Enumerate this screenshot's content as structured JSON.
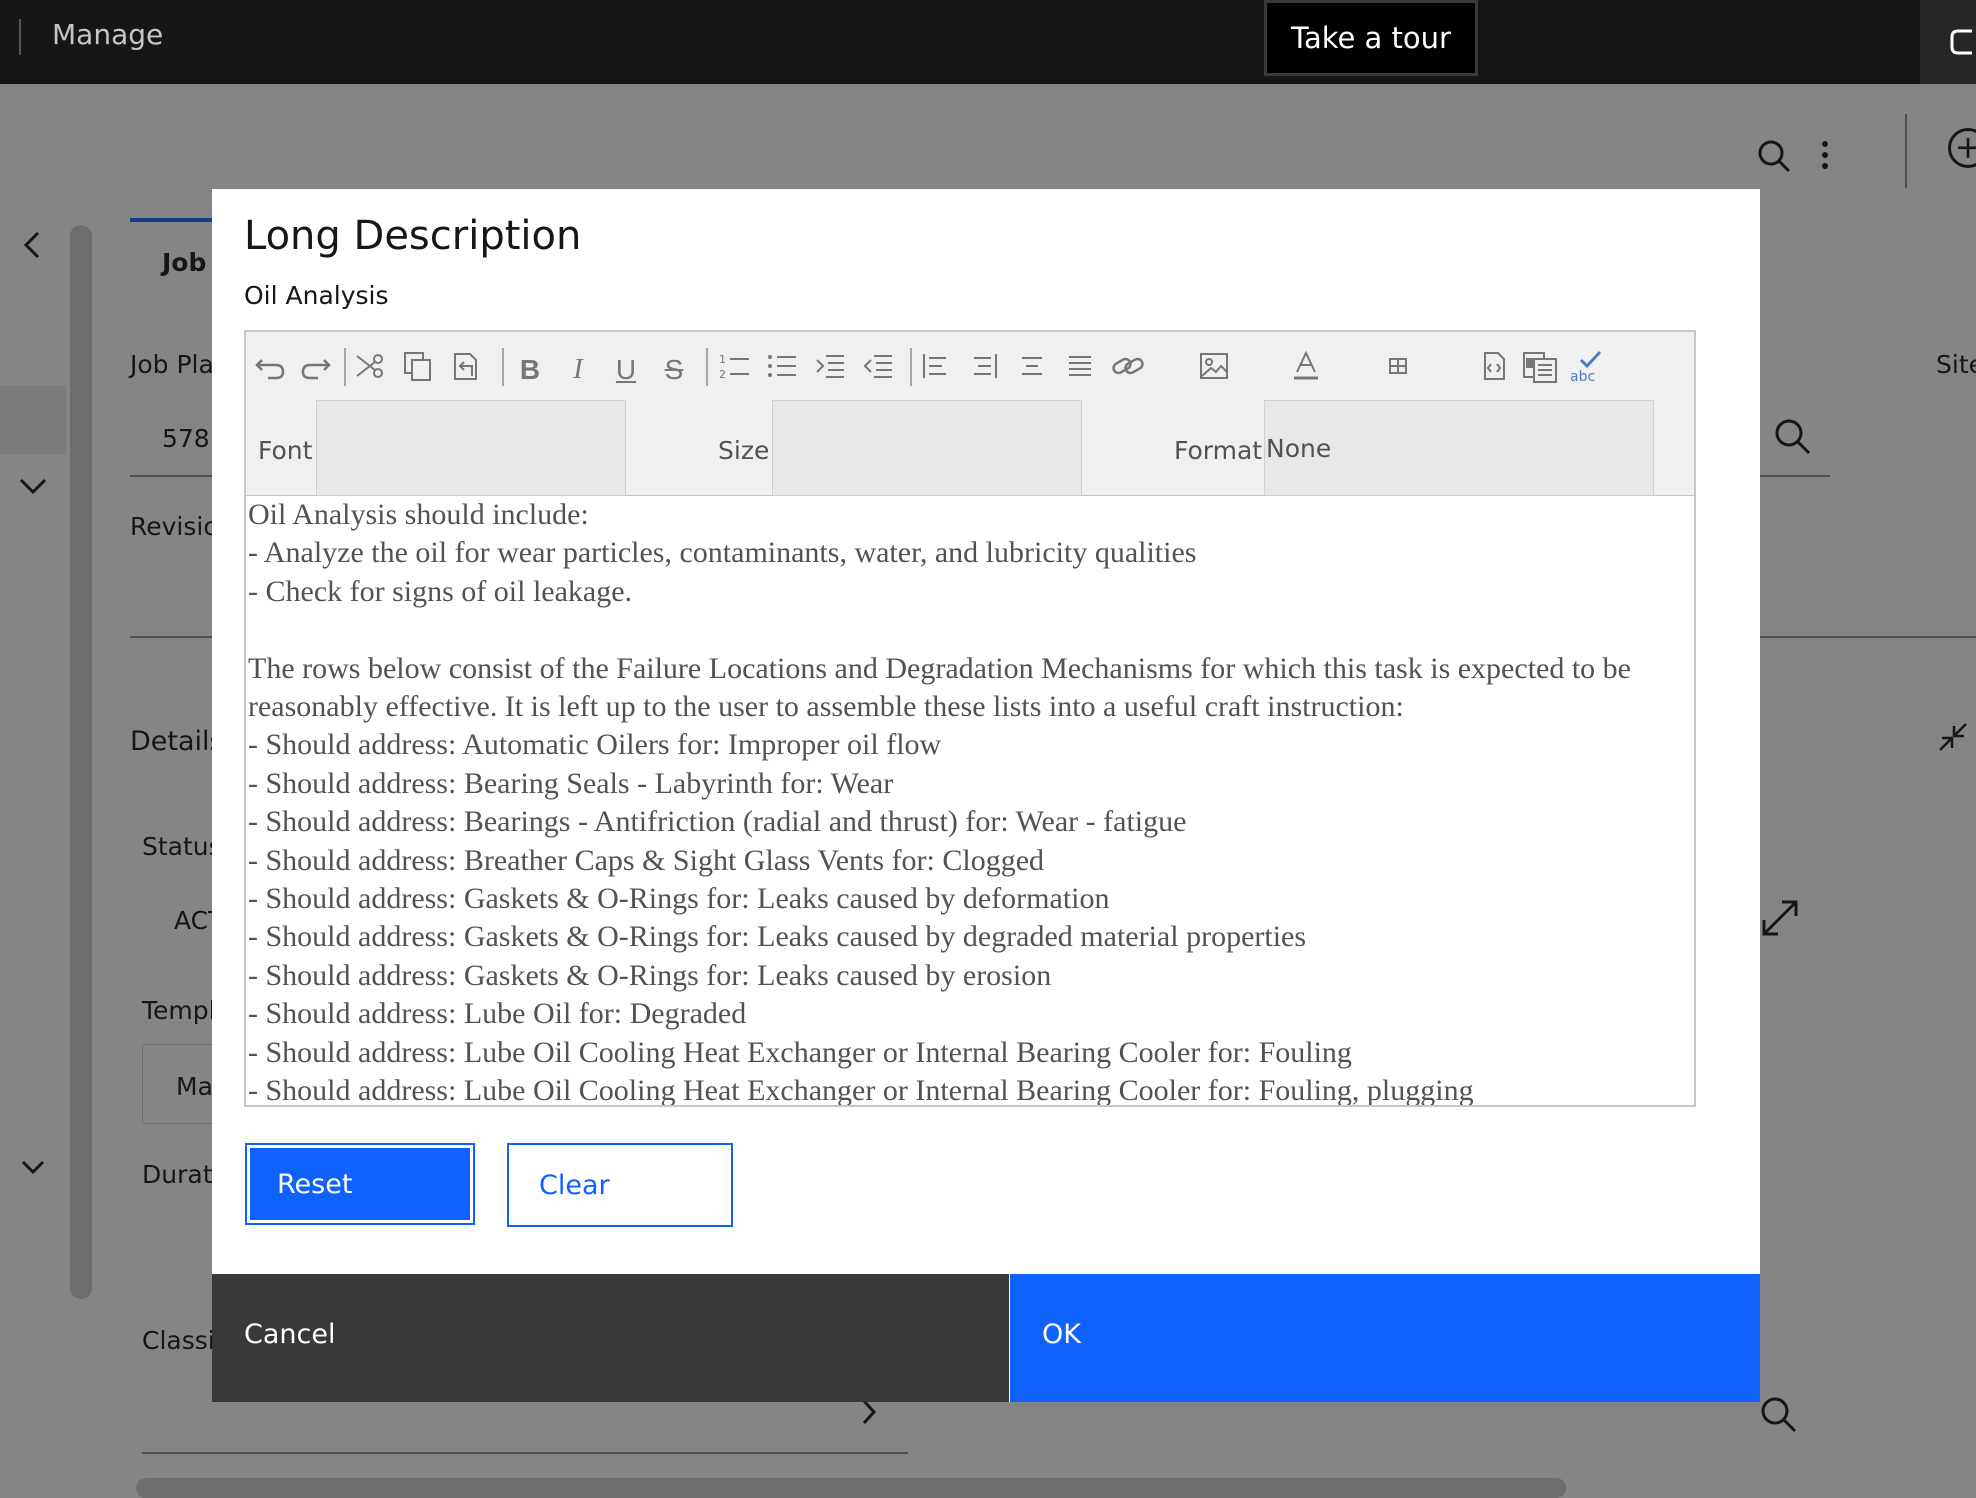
{
  "topbar": {
    "app_name": "Manage",
    "tour_button": "Take a tour"
  },
  "background": {
    "tab_label": "Job",
    "job_plan_label": "Job Pla",
    "job_plan_value": "578",
    "revision_label": "Revisio",
    "details_label": "Details",
    "status_label": "Status",
    "status_value": "ACT",
    "template_label": "Templ",
    "template_value": "Ma",
    "duration_label": "Durati",
    "classification_label": "Classi",
    "site_label": "Site"
  },
  "modal": {
    "title": "Long Description",
    "subtitle": "Oil Analysis",
    "editor": {
      "toolbar": {
        "font_label": "Font",
        "font_value": "",
        "size_label": "Size",
        "size_value": "",
        "format_label": "Format",
        "format_value": "None"
      },
      "lines": [
        "Oil Analysis should include:",
        "- Analyze the oil for wear particles, contaminants, water, and lubricity qualities",
        "- Check for signs of oil leakage.",
        "",
        "The rows below consist of the Failure Locations and Degradation Mechanisms for which this task is expected to be reasonably effective.  It is left up to the user to assemble these lists into a useful craft instruction:",
        "- Should address: Automatic Oilers for: Improper oil flow",
        "- Should address: Bearing Seals - Labyrinth for: Wear",
        "- Should address: Bearings - Antifriction (radial and thrust) for: Wear - fatigue",
        "- Should address: Breather Caps & Sight Glass Vents for: Clogged",
        "- Should address: Gaskets & O-Rings for: Leaks caused by deformation",
        "- Should address: Gaskets & O-Rings for: Leaks caused by degraded material properties",
        "- Should address: Gaskets & O-Rings for: Leaks caused by erosion",
        "- Should address: Lube Oil for: Degraded",
        "- Should address: Lube Oil Cooling Heat Exchanger or Internal Bearing Cooler for: Fouling",
        "- Should address: Lube Oil Cooling Heat Exchanger or Internal Bearing Cooler for: Fouling, plugging"
      ]
    },
    "reset_button": "Reset",
    "clear_button": "Clear",
    "cancel_button": "Cancel",
    "ok_button": "OK"
  },
  "colors": {
    "primary": "#0f62fe",
    "dark": "#161616",
    "secondary_button": "#393939"
  }
}
